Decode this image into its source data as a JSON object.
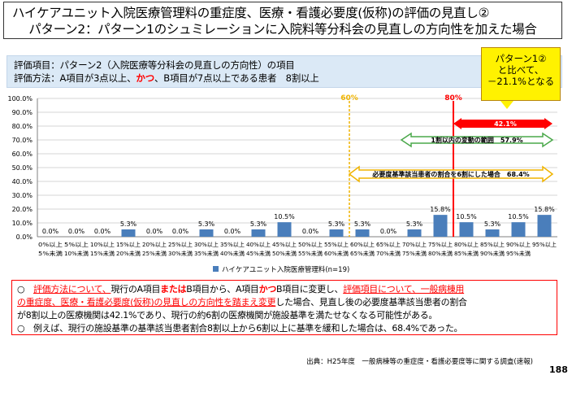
{
  "title": {
    "line1": "ハイケアユニット入院医療管理料の重症度、医療・看護必要度(仮称)の評価の見直し②",
    "line2": "パターン2：パターン1のシュミレーションに入院料等分科会の見直しの方向性を加えた場合"
  },
  "criteria": {
    "line1": "評価項目：パターン2（入院医療等分科会の見直しの方向性）の項目",
    "line2_prefix": "評価方法：A項目が3点以上、",
    "line2_highlight": "かつ",
    "line2_suffix": "、B項目が7点以上である患者　8割以上"
  },
  "callout": {
    "line1": "パターン1②",
    "line2": "と比べて、",
    "line3": "－21.1%となる"
  },
  "chart_data": {
    "type": "bar",
    "categories": [
      [
        "0%以上",
        "5%未満"
      ],
      [
        "5%以上",
        "10%未満"
      ],
      [
        "10%以上",
        "15%未満"
      ],
      [
        "15%以上",
        "20%未満"
      ],
      [
        "20%以上",
        "25%未満"
      ],
      [
        "25%以上",
        "30%未満"
      ],
      [
        "30%以上",
        "35%未満"
      ],
      [
        "35%以上",
        "40%未満"
      ],
      [
        "40%以上",
        "45%未満"
      ],
      [
        "45%以上",
        "50%未満"
      ],
      [
        "50%以上",
        "55%未満"
      ],
      [
        "55%以上",
        "60%未満"
      ],
      [
        "60%以上",
        "65%未満"
      ],
      [
        "65%以上",
        "70%未満"
      ],
      [
        "70%以上",
        "75%未満"
      ],
      [
        "75%以上",
        "80%未満"
      ],
      [
        "80%以上",
        "85%未満"
      ],
      [
        "85%以上",
        "90%未満"
      ],
      [
        "90%以上",
        "95%未満"
      ],
      [
        "95%以上",
        ""
      ]
    ],
    "series": [
      {
        "name": "ハイケアユニット入院医療管理料(n=19)",
        "values": [
          0.0,
          0.0,
          0.0,
          5.3,
          0.0,
          0.0,
          5.3,
          0.0,
          5.3,
          10.5,
          0.0,
          5.3,
          5.3,
          0.0,
          5.3,
          15.8,
          10.5,
          5.3,
          10.5,
          15.8
        ],
        "labels": [
          "0.0%",
          "0.0%",
          "0.0%",
          "5.3%",
          "0.0%",
          "0.0%",
          "5.3%",
          "0.0%",
          "5.3%",
          "10.5%",
          "0.0%",
          "5.3%",
          "5.3%",
          "0.0%",
          "5.3%",
          "15.8%",
          "10.5%",
          "5.3%",
          "10.5%",
          "15.8%"
        ]
      }
    ],
    "ylim": [
      0,
      100
    ],
    "yticks": [
      "0.0%",
      "10.0%",
      "20.0%",
      "30.0%",
      "40.0%",
      "50.0%",
      "60.0%",
      "70.0%",
      "80.0%",
      "90.0%",
      "100.0%"
    ],
    "grid": true,
    "legend": "bottom",
    "bar_color": "#4a7ebb",
    "reference_lines": [
      {
        "label": "60%",
        "category_index": 12,
        "color": "#f0b400"
      },
      {
        "label": "80%",
        "category_index": 16,
        "color": "#ff0000"
      }
    ],
    "annotations": {
      "red_arrow_label": "42.1%",
      "green_arrow_label": "1割以内の変動の範囲　57.9%",
      "yellow_arrow_label": "必要度基準該当患者の割合を6割にした場合　68.4%"
    }
  },
  "notes": {
    "l1_bullet": "○　",
    "l1_a": "評価方法について、",
    "l1_b": "現行のA項目",
    "l1_c": "または",
    "l1_d": "B項目から、A項目",
    "l1_e": "かつ",
    "l1_f": "B項目に変更し、",
    "l1_g": "評価項目について、一般病棟用",
    "l2_a": "の重症度、医療・看護必要度(仮称)の見直しの方向性を踏まえ変更",
    "l2_b": "した場合、見直し後の必要度基準該当患者の割合",
    "l3": "が8割以上の医療機関は42.1%であり、現行の約6割の医療機関が施設基準を満たせなくなる可能性がある。",
    "l4": "○　例えば、現行の施設基準の基準該当患者割合8割以上から6割以上に基準を緩和した場合は、68.4%であった。"
  },
  "source": "出典：H25年度　一般病棟等の重症度・看護必要度等に関する調査(速報)",
  "page_number": "188"
}
